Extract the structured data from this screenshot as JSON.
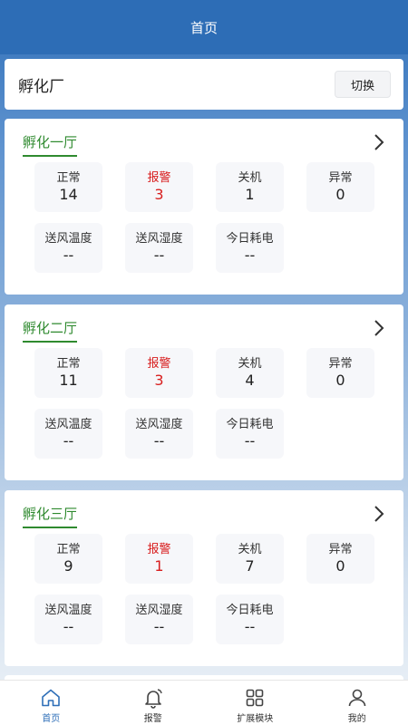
{
  "header": {
    "title": "首页"
  },
  "factory": {
    "name": "孵化厂",
    "switch_label": "切换"
  },
  "colors": {
    "header_bg": "#2d6db6",
    "accent_green": "#2f8a2f",
    "alarm_red": "#d81e1e",
    "tab_active": "#2f6fb8"
  },
  "halls": [
    {
      "title": "孵化一厅",
      "stats": [
        {
          "label": "正常",
          "value": "14"
        },
        {
          "label": "报警",
          "value": "3"
        },
        {
          "label": "关机",
          "value": "1"
        },
        {
          "label": "异常",
          "value": "0"
        },
        {
          "label": "送风温度",
          "value": "--"
        },
        {
          "label": "送风湿度",
          "value": "--"
        },
        {
          "label": "今日耗电",
          "value": "--"
        }
      ]
    },
    {
      "title": "孵化二厅",
      "stats": [
        {
          "label": "正常",
          "value": "11"
        },
        {
          "label": "报警",
          "value": "3"
        },
        {
          "label": "关机",
          "value": "4"
        },
        {
          "label": "异常",
          "value": "0"
        },
        {
          "label": "送风温度",
          "value": "--"
        },
        {
          "label": "送风湿度",
          "value": "--"
        },
        {
          "label": "今日耗电",
          "value": "--"
        }
      ]
    },
    {
      "title": "孵化三厅",
      "stats": [
        {
          "label": "正常",
          "value": "9"
        },
        {
          "label": "报警",
          "value": "1"
        },
        {
          "label": "关机",
          "value": "7"
        },
        {
          "label": "异常",
          "value": "0"
        },
        {
          "label": "送风温度",
          "value": "--"
        },
        {
          "label": "送风湿度",
          "value": "--"
        },
        {
          "label": "今日耗电",
          "value": "--"
        }
      ]
    }
  ],
  "tabs": [
    {
      "label": "首页",
      "icon": "home-icon",
      "active": true
    },
    {
      "label": "报警",
      "icon": "bell-icon",
      "active": false
    },
    {
      "label": "扩展模块",
      "icon": "grid-icon",
      "active": false
    },
    {
      "label": "我的",
      "icon": "user-icon",
      "active": false
    }
  ]
}
